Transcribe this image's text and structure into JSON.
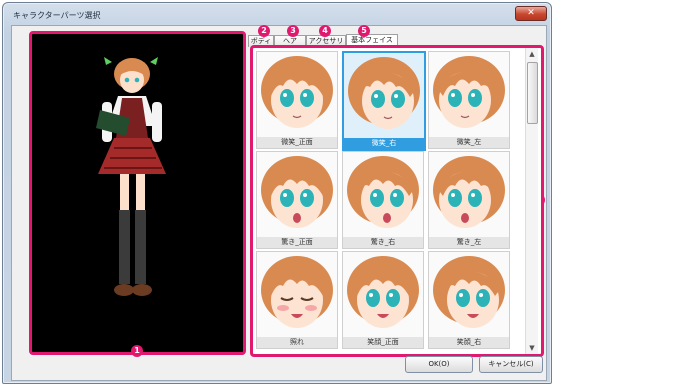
{
  "window": {
    "title": "キャラクターパーツ選択",
    "close_glyph": "✕"
  },
  "tabs": [
    {
      "label": "ボディ",
      "active": false
    },
    {
      "label": "ヘア",
      "active": false
    },
    {
      "label": "アクセサリ",
      "active": false
    },
    {
      "label": "基本フェイス",
      "active": true
    }
  ],
  "markers": [
    "1",
    "2",
    "3",
    "4",
    "5",
    "6"
  ],
  "faces": [
    {
      "label": "微笑_正面",
      "selected": false,
      "expression": "smile",
      "view": "front"
    },
    {
      "label": "微笑_右",
      "selected": true,
      "expression": "smile",
      "view": "right"
    },
    {
      "label": "微笑_左",
      "selected": false,
      "expression": "smile",
      "view": "left"
    },
    {
      "label": "驚き_正面",
      "selected": false,
      "expression": "surprised",
      "view": "front"
    },
    {
      "label": "驚き_右",
      "selected": false,
      "expression": "surprised",
      "view": "right"
    },
    {
      "label": "驚き_左",
      "selected": false,
      "expression": "surprised",
      "view": "left"
    },
    {
      "label": "照れ",
      "selected": false,
      "expression": "shy",
      "view": "front"
    },
    {
      "label": "笑顔_正面",
      "selected": false,
      "expression": "laugh",
      "view": "front"
    },
    {
      "label": "笑顔_右",
      "selected": false,
      "expression": "laugh",
      "view": "right"
    }
  ],
  "buttons": {
    "ok": "OK(O)",
    "cancel": "キャンセル(C)"
  },
  "scrollbar": {
    "up_glyph": "▲",
    "down_glyph": "▼"
  },
  "colors": {
    "accent": "#e0196f",
    "selection": "#2f9de0",
    "hair": "#d98a50",
    "eyes": "#2bb3b8"
  }
}
